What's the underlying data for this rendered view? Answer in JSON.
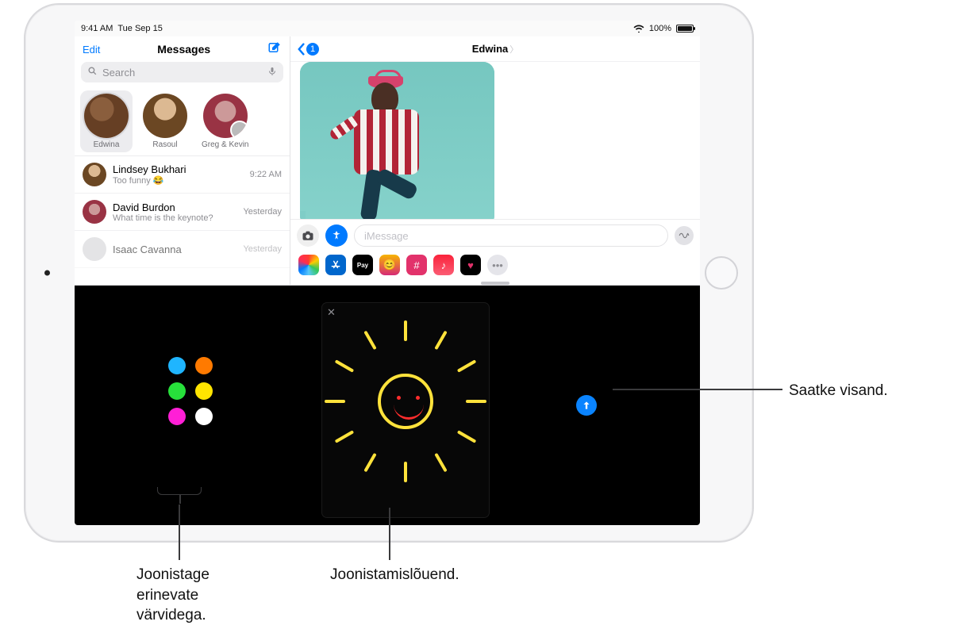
{
  "status": {
    "time": "9:41 AM",
    "date": "Tue Sep 15",
    "battery": "100%"
  },
  "sidebar": {
    "edit": "Edit",
    "title": "Messages",
    "search_placeholder": "Search",
    "pinned": [
      {
        "name": "Edwina"
      },
      {
        "name": "Rasoul"
      },
      {
        "name": "Greg & Kevin"
      }
    ],
    "conversations": [
      {
        "name": "Lindsey Bukhari",
        "sub": "Too funny 😂",
        "time": "9:22 AM"
      },
      {
        "name": "David Burdon",
        "sub": "What time is the keynote?",
        "time": "Yesterday"
      },
      {
        "name": "Isaac Cavanna",
        "sub": "",
        "time": "Yesterday"
      }
    ]
  },
  "main": {
    "back_badge": "1",
    "contact": "Edwina",
    "input_placeholder": "iMessage",
    "apple_pay": "Pay"
  },
  "palette": {
    "colors": [
      "#ff1f1f",
      "#1fb5ff",
      "#ff7a00",
      "#27e03b",
      "#ffe400",
      "#ff1fd6",
      "#ffffff"
    ],
    "selected": "#ff1f1f"
  },
  "callouts": {
    "send": "Saatke visand.",
    "canvas": "Joonistamislõuend.",
    "colors": "Joonistage\nerinevate\nvärvidega."
  }
}
